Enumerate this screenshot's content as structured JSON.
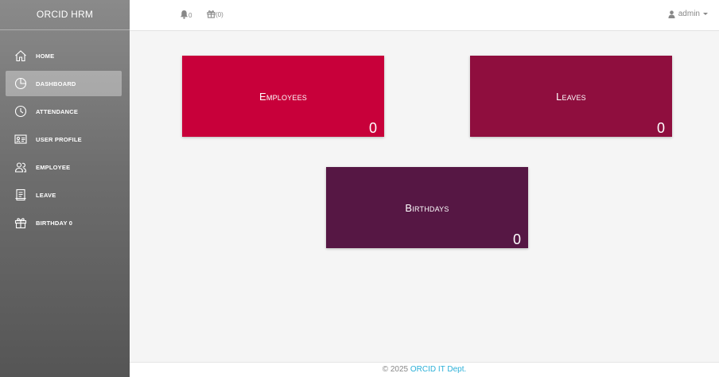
{
  "app": {
    "brand": "ORCID HRM"
  },
  "sidebar": {
    "items": [
      {
        "label": "HOME",
        "icon": "home-icon",
        "active": false
      },
      {
        "label": "DASHBOARD",
        "icon": "pie-chart-icon",
        "active": true
      },
      {
        "label": "ATTENDANCE",
        "icon": "clock-icon",
        "active": false
      },
      {
        "label": "USER PROFILE",
        "icon": "id-card-icon",
        "active": false
      },
      {
        "label": "EMPLOYEE",
        "icon": "users-icon",
        "active": false
      },
      {
        "label": "LEAVE",
        "icon": "document-icon",
        "active": false
      },
      {
        "label": "BIRTHDAY 0",
        "icon": "gift-icon",
        "active": false
      }
    ]
  },
  "topbar": {
    "notifications_count": "0",
    "birthdays_count": "(0)",
    "user": "admin"
  },
  "cards": {
    "employees": {
      "title": "Employees",
      "count": "0",
      "color": "#c8003a"
    },
    "leaves": {
      "title": "Leaves",
      "count": "0",
      "color": "#8f0e3e"
    },
    "birthdays": {
      "title": "Birthdays",
      "count": "0",
      "color": "#561744"
    }
  },
  "footer": {
    "copyright": "© 2025",
    "link": "ORCID IT Dept."
  }
}
